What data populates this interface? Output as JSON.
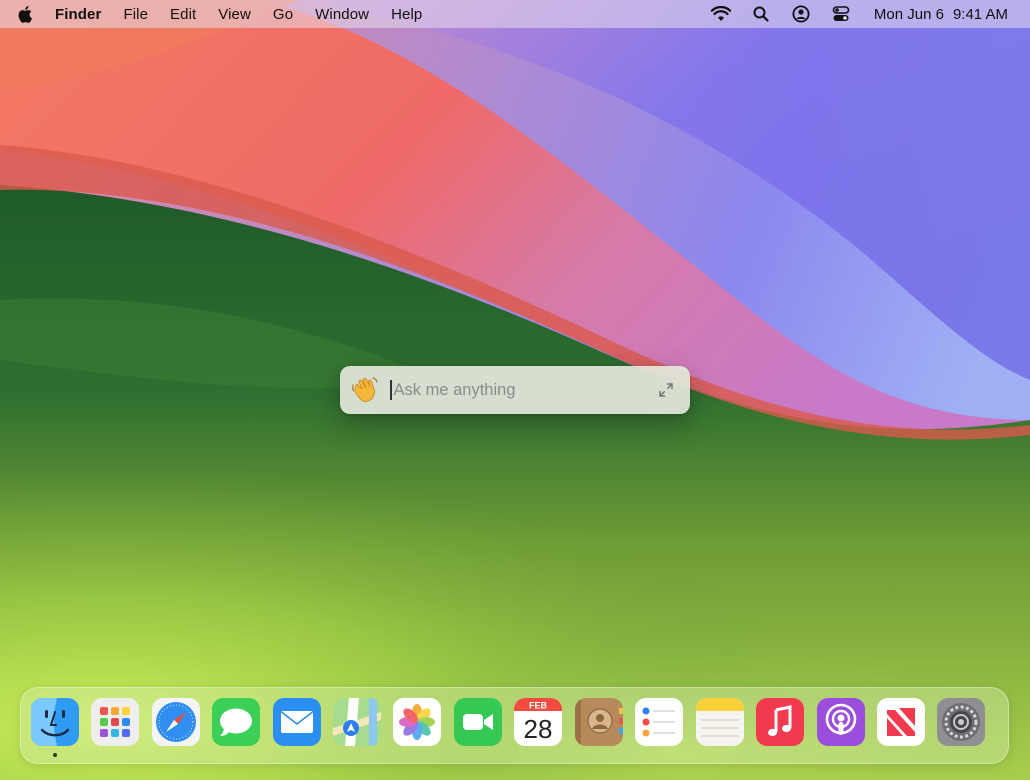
{
  "menubar": {
    "apple_icon": "apple-logo-icon",
    "app_name": "Finder",
    "menus": [
      "File",
      "Edit",
      "View",
      "Go",
      "Window",
      "Help"
    ],
    "status_icons": [
      "wifi-icon",
      "spotlight-search-icon",
      "user-account-icon",
      "control-center-icon"
    ],
    "date": "Mon Jun 6",
    "time": "9:41 AM"
  },
  "ask_box": {
    "emoji": "👋",
    "placeholder": "Ask me anything",
    "expand_icon": "expand-icon"
  },
  "dock": {
    "apps": [
      {
        "name": "Finder",
        "icon": "finder-icon",
        "running": true
      },
      {
        "name": "Launchpad",
        "icon": "launchpad-icon",
        "running": false
      },
      {
        "name": "Safari",
        "icon": "safari-icon",
        "running": false
      },
      {
        "name": "Messages",
        "icon": "messages-icon",
        "running": false
      },
      {
        "name": "Mail",
        "icon": "mail-icon",
        "running": false
      },
      {
        "name": "Maps",
        "icon": "maps-icon",
        "running": false
      },
      {
        "name": "Photos",
        "icon": "photos-icon",
        "running": false
      },
      {
        "name": "FaceTime",
        "icon": "facetime-icon",
        "running": false
      },
      {
        "name": "Calendar",
        "icon": "calendar-icon",
        "running": false
      },
      {
        "name": "Contacts",
        "icon": "contacts-icon",
        "running": false
      },
      {
        "name": "Reminders",
        "icon": "reminders-icon",
        "running": false
      },
      {
        "name": "Notes",
        "icon": "notes-icon",
        "running": false
      },
      {
        "name": "Music",
        "icon": "music-icon",
        "running": false
      },
      {
        "name": "Podcasts",
        "icon": "podcasts-icon",
        "running": false
      },
      {
        "name": "News",
        "icon": "news-icon",
        "running": false
      },
      {
        "name": "System Settings",
        "icon": "system-settings-icon",
        "running": false
      }
    ],
    "calendar": {
      "month": "FEB",
      "day": "28"
    }
  }
}
